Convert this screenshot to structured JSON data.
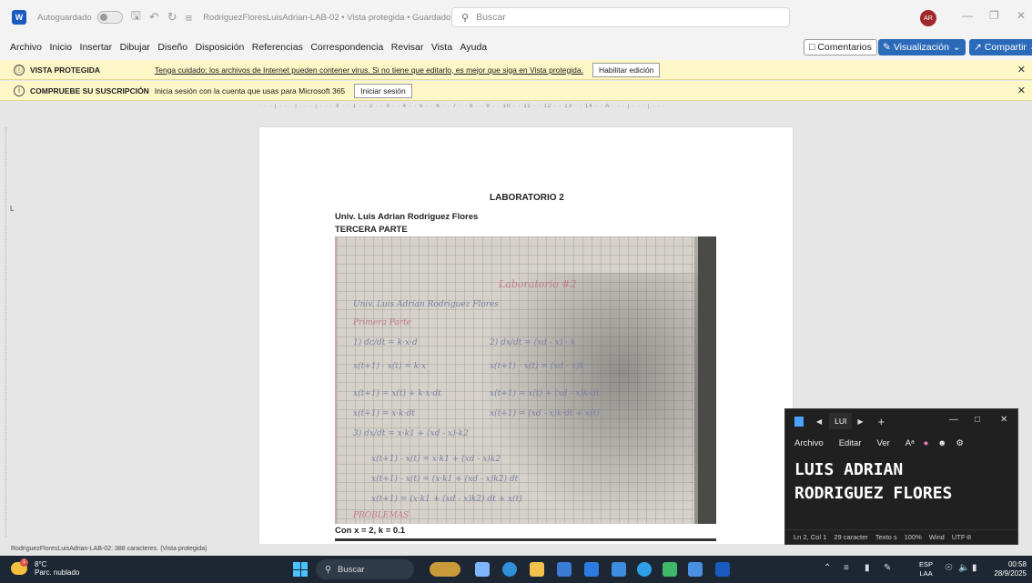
{
  "titlebar": {
    "app_icon": "W",
    "autosave": "Autoguardado",
    "document_title": "RodriguezFloresLuisAdrian-LAB-02 • Vista protegida • Guardado ∨",
    "search_placeholder": "Buscar",
    "avatar_initials": "AR"
  },
  "menu": {
    "items": [
      "Archivo",
      "Inicio",
      "Insertar",
      "Dibujar",
      "Diseño",
      "Disposición",
      "Referencias",
      "Correspondencia",
      "Revisar",
      "Vista",
      "Ayuda"
    ],
    "comments": "Comentarios",
    "view_mode": "Visualización",
    "share": "Compartir"
  },
  "protected_bar": {
    "title": "VISTA PROTEGIDA",
    "message": "Tenga cuidado: los archivos de Internet pueden contener virus. Si no tiene que editarlo, es mejor que siga en Vista protegida.",
    "button": "Habilitar edición"
  },
  "subscription_bar": {
    "title": "COMPRUEBE SU SUSCRIPCIÓN",
    "message": "Inicia sesión con la cuenta que usas para Microsoft 365",
    "button": "Iniciar sesión"
  },
  "ruler": {
    "ticks": "· · · | · · · | · · · | · · · X · · 1 · · 2 · · 3 · · 4 · · 5 · · 6 · · 7 · · 8 · · 9 · · 10 · · 11 · · 12 · · 13 · · 14 · · A · · · | · · · | · · ·"
  },
  "document": {
    "title": "LABORATORIO 2",
    "author": "Univ. Luis Adrian Rodriguez Flores",
    "part": "TERCERA PARTE",
    "photo_lines": [
      "Laboratorio #2",
      "Univ. Luis Adrian Rodriguez Flores",
      "Primera Parte",
      "1) dc/dt = k·x·d",
      "2) dx/dt = (xd - x) · k",
      "x(t+1) - x(t) = k·x",
      "x(t+1) - x(t) = (xd - x)k",
      "x(t+1) = x(t) + k·x·dt",
      "x(t+1) = x(t) + (xd - x)k·dt",
      "x(t+1) = x·k·dt",
      "x(t+1) = (xd - x)k·dt + x(t)",
      "3) dx/dt = x·k1 + (xd - x)·k2",
      "x(t+1) - x(t) = x·k1 + (xd - x)k2",
      "x(t+1) - x(t) = (x·k1 + (xd - x)k2) dt",
      "x(t+1) = (x·k1 + (xd - x)k2) dt + x(t)",
      "PROBLEMAS"
    ],
    "condition": "Con x = 2, k = 0.1"
  },
  "statusbar": {
    "text": "RodriguezFloresLuisAdrian-LAB-02: 388 caracteres. (Vista protegida)"
  },
  "notepad": {
    "tab": "LUI",
    "menu": [
      "Archivo",
      "Editar",
      "Ver"
    ],
    "text_line1": "LUIS ADRIAN",
    "text_line2": "RODRIGUEZ FLORES",
    "status": [
      "Ln 2, Col 1",
      "29 caracter",
      "Texto s",
      "100%",
      "Wind",
      "UTF-8"
    ]
  },
  "taskbar": {
    "temperature": "8°C",
    "weather": "Parc. nublado",
    "weather_badge": "1",
    "search": "Buscar",
    "language": "ESP",
    "language_sub": "LAA",
    "time": "00:58",
    "date": "28/9/2025"
  },
  "colors": {
    "word_blue": "#185abd",
    "info_bar": "#fdf6c6",
    "accent_button": "#2b6ab8",
    "taskbar": "#1c2733",
    "notepad_bg": "#202020"
  }
}
